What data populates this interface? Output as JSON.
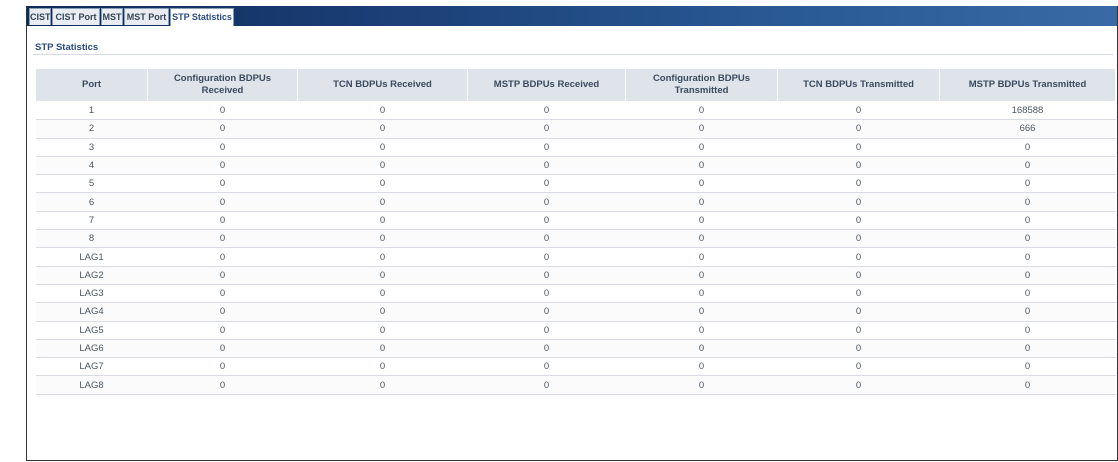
{
  "tabs": [
    {
      "label": "CIST"
    },
    {
      "label": "CIST Port"
    },
    {
      "label": "MST"
    },
    {
      "label": "MST Port"
    },
    {
      "label": "STP Statistics"
    }
  ],
  "active_tab": "STP Statistics",
  "section_title": "STP Statistics",
  "columns": [
    "Port",
    "Configuration BDPUs Received",
    "TCN BDPUs Received",
    "MSTP BDPUs Received",
    "Configuration BDPUs Transmitted",
    "TCN BDPUs Transmitted",
    "MSTP BDPUs Transmitted"
  ],
  "rows": [
    [
      "1",
      "0",
      "0",
      "0",
      "0",
      "0",
      "168588"
    ],
    [
      "2",
      "0",
      "0",
      "0",
      "0",
      "0",
      "666"
    ],
    [
      "3",
      "0",
      "0",
      "0",
      "0",
      "0",
      "0"
    ],
    [
      "4",
      "0",
      "0",
      "0",
      "0",
      "0",
      "0"
    ],
    [
      "5",
      "0",
      "0",
      "0",
      "0",
      "0",
      "0"
    ],
    [
      "6",
      "0",
      "0",
      "0",
      "0",
      "0",
      "0"
    ],
    [
      "7",
      "0",
      "0",
      "0",
      "0",
      "0",
      "0"
    ],
    [
      "8",
      "0",
      "0",
      "0",
      "0",
      "0",
      "0"
    ],
    [
      "LAG1",
      "0",
      "0",
      "0",
      "0",
      "0",
      "0"
    ],
    [
      "LAG2",
      "0",
      "0",
      "0",
      "0",
      "0",
      "0"
    ],
    [
      "LAG3",
      "0",
      "0",
      "0",
      "0",
      "0",
      "0"
    ],
    [
      "LAG4",
      "0",
      "0",
      "0",
      "0",
      "0",
      "0"
    ],
    [
      "LAG5",
      "0",
      "0",
      "0",
      "0",
      "0",
      "0"
    ],
    [
      "LAG6",
      "0",
      "0",
      "0",
      "0",
      "0",
      "0"
    ],
    [
      "LAG7",
      "0",
      "0",
      "0",
      "0",
      "0",
      "0"
    ],
    [
      "LAG8",
      "0",
      "0",
      "0",
      "0",
      "0",
      "0"
    ]
  ]
}
